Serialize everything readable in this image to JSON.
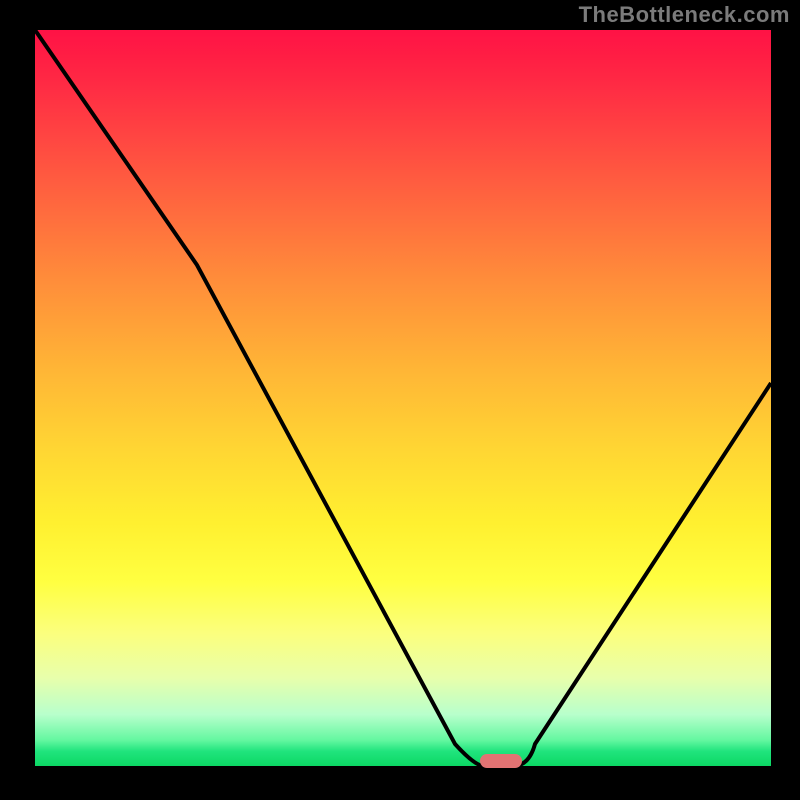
{
  "watermark": "TheBottleneck.com",
  "chart_data": {
    "type": "line",
    "title": "",
    "xlabel": "",
    "ylabel": "",
    "xlim": [
      0,
      100
    ],
    "ylim": [
      0,
      100
    ],
    "x": [
      0,
      22,
      57,
      61,
      65,
      68,
      100
    ],
    "values": [
      100,
      68,
      3,
      0,
      0,
      3,
      52
    ],
    "marker": {
      "x_start": 61,
      "x_end": 66,
      "y": 0
    },
    "gradient": {
      "top_color": "#ff1245",
      "bottom_color": "#0cd864"
    }
  }
}
